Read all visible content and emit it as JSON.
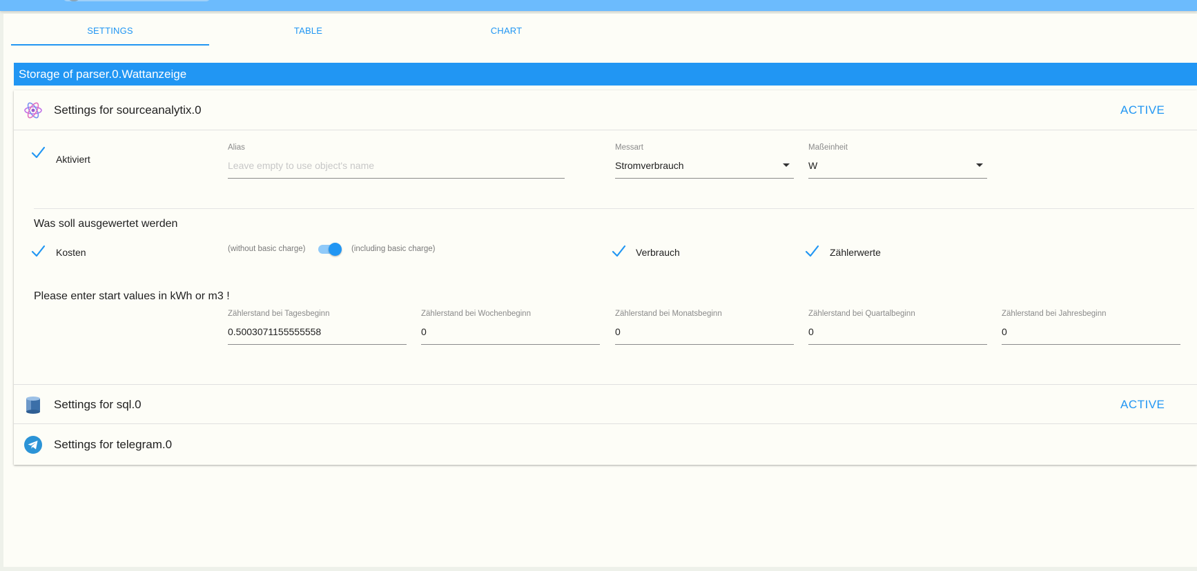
{
  "tabs": [
    {
      "label": "SETTINGS",
      "active": true
    },
    {
      "label": "TABLE",
      "active": false
    },
    {
      "label": "CHART",
      "active": false
    }
  ],
  "storage_header": "Storage of parser.0.Wattanzeige",
  "sections": {
    "sourceanalytix": {
      "title": "Settings for sourceanalytix.0",
      "status": "ACTIVE",
      "icon": "atom-icon",
      "aktiviert_label": "Aktiviert",
      "alias": {
        "label": "Alias",
        "value": "",
        "placeholder": "Leave empty to use object's name"
      },
      "messart": {
        "label": "Messart",
        "value": "Stromverbrauch"
      },
      "masseinheit": {
        "label": "Maßeinheit",
        "value": "W"
      },
      "eval_title": "Was soll ausgewertet werden",
      "kosten_label": "Kosten",
      "without_basic": "(without basic charge)",
      "including_basic": "(including basic charge)",
      "basic_charge_switch": true,
      "verbrauch_label": "Verbrauch",
      "zaehlerwerte_label": "Zählerwerte",
      "start_values_title": "Please enter start values in kWh or m3 !",
      "start_values": [
        {
          "label": "Zählerstand bei Tagesbeginn",
          "value": "0.5003071155555558"
        },
        {
          "label": "Zählerstand bei Wochenbeginn",
          "value": "0"
        },
        {
          "label": "Zählerstand bei Monatsbeginn",
          "value": "0"
        },
        {
          "label": "Zählerstand bei Quartalbeginn",
          "value": "0"
        },
        {
          "label": "Zählerstand bei Jahresbeginn",
          "value": "0"
        }
      ]
    },
    "sql": {
      "title": "Settings for sql.0",
      "status": "ACTIVE",
      "icon": "database-icon"
    },
    "telegram": {
      "title": "Settings for telegram.0",
      "icon": "telegram-icon"
    }
  },
  "colors": {
    "accent": "#2196f3",
    "topbar": "#6cbbfd",
    "background": "#fdfdf7"
  }
}
